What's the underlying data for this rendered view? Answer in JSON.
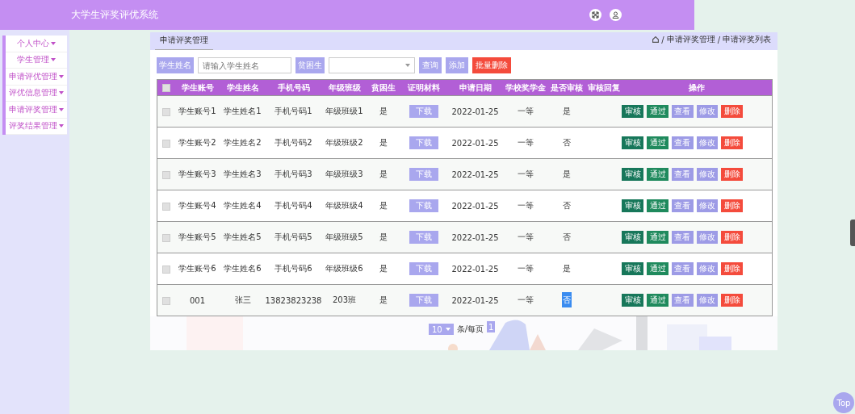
{
  "header": {
    "title": "大学生评奖评优系统"
  },
  "sidebar": {
    "items": [
      {
        "label": "个人中心"
      },
      {
        "label": "学生管理"
      },
      {
        "label": "申请评优管理"
      },
      {
        "label": "评优信息管理"
      },
      {
        "label": "申请评奖管理"
      },
      {
        "label": "评奖结果管理"
      }
    ]
  },
  "tab": {
    "label": "申请评奖管理"
  },
  "breadcrumb": [
    "/",
    "申请评奖管理",
    "/",
    "申请评奖列表"
  ],
  "toolbar": {
    "name_label": "学生姓名",
    "name_placeholder": "请输入学生姓名",
    "poor_label": "贫困生",
    "buttons": [
      {
        "label": "查询",
        "kind": "primary"
      },
      {
        "label": "添加",
        "kind": "primary"
      },
      {
        "label": "批量删除",
        "kind": "danger"
      }
    ]
  },
  "table": {
    "select_all_checked": false,
    "columns": [
      "学生账号",
      "学生姓名",
      "手机号码",
      "年级班级",
      "贫困生",
      "证明材料",
      "申请日期",
      "学校奖学金",
      "是否审核",
      "审核回复",
      "操作"
    ],
    "rows": [
      {
        "checked": false,
        "cells": [
          "学生账号1",
          "学生姓名1",
          "手机号码1",
          "年级班级1",
          "是",
          "下载",
          "2022-01-25",
          "一等",
          "是",
          ""
        ],
        "highlighted": false,
        "actions": [
          {
            "label": "审核",
            "kind": "dark"
          },
          {
            "label": "通过",
            "kind": "green"
          },
          {
            "label": "查看",
            "kind": "light"
          },
          {
            "label": "修改",
            "kind": "light"
          },
          {
            "label": "删除",
            "kind": "danger"
          }
        ]
      },
      {
        "checked": false,
        "cells": [
          "学生账号2",
          "学生姓名2",
          "手机号码2",
          "年级班级2",
          "是",
          "下载",
          "2022-01-25",
          "一等",
          "否",
          ""
        ],
        "highlighted": false,
        "actions": [
          {
            "label": "审核",
            "kind": "dark"
          },
          {
            "label": "通过",
            "kind": "green"
          },
          {
            "label": "查看",
            "kind": "light"
          },
          {
            "label": "修改",
            "kind": "light"
          },
          {
            "label": "删除",
            "kind": "danger"
          }
        ]
      },
      {
        "checked": false,
        "cells": [
          "学生账号3",
          "学生姓名3",
          "手机号码3",
          "年级班级3",
          "是",
          "下载",
          "2022-01-25",
          "一等",
          "是",
          ""
        ],
        "highlighted": false,
        "actions": [
          {
            "label": "审核",
            "kind": "dark"
          },
          {
            "label": "通过",
            "kind": "green"
          },
          {
            "label": "查看",
            "kind": "light"
          },
          {
            "label": "修改",
            "kind": "light"
          },
          {
            "label": "删除",
            "kind": "danger"
          }
        ]
      },
      {
        "checked": false,
        "cells": [
          "学生账号4",
          "学生姓名4",
          "手机号码4",
          "年级班级4",
          "是",
          "下载",
          "2022-01-25",
          "一等",
          "否",
          ""
        ],
        "highlighted": false,
        "actions": [
          {
            "label": "审核",
            "kind": "dark"
          },
          {
            "label": "通过",
            "kind": "green"
          },
          {
            "label": "查看",
            "kind": "light"
          },
          {
            "label": "修改",
            "kind": "light"
          },
          {
            "label": "删除",
            "kind": "danger"
          }
        ]
      },
      {
        "checked": false,
        "cells": [
          "学生账号5",
          "学生姓名5",
          "手机号码5",
          "年级班级5",
          "是",
          "下载",
          "2022-01-25",
          "一等",
          "否",
          ""
        ],
        "highlighted": false,
        "actions": [
          {
            "label": "审核",
            "kind": "dark"
          },
          {
            "label": "通过",
            "kind": "green"
          },
          {
            "label": "查看",
            "kind": "light"
          },
          {
            "label": "修改",
            "kind": "light"
          },
          {
            "label": "删除",
            "kind": "danger"
          }
        ]
      },
      {
        "checked": false,
        "cells": [
          "学生账号6",
          "学生姓名6",
          "手机号码6",
          "年级班级6",
          "是",
          "下载",
          "2022-01-25",
          "一等",
          "是",
          ""
        ],
        "highlighted": false,
        "actions": [
          {
            "label": "审核",
            "kind": "dark"
          },
          {
            "label": "通过",
            "kind": "green"
          },
          {
            "label": "查看",
            "kind": "light"
          },
          {
            "label": "修改",
            "kind": "light"
          },
          {
            "label": "删除",
            "kind": "danger"
          }
        ]
      },
      {
        "checked": false,
        "cells": [
          "001",
          "张三",
          "13823823238",
          "203班",
          "是",
          "下载",
          "2022-01-25",
          "一等",
          "否",
          ""
        ],
        "highlighted": true,
        "actions": [
          {
            "label": "审核",
            "kind": "dark"
          },
          {
            "label": "通过",
            "kind": "green"
          },
          {
            "label": "查看",
            "kind": "light"
          },
          {
            "label": "修改",
            "kind": "light"
          },
          {
            "label": "删除",
            "kind": "danger"
          }
        ]
      }
    ]
  },
  "pagination": {
    "page_size": "10",
    "per_page_label": "条/每页",
    "pages": [
      {
        "label": "1",
        "selected": true
      }
    ]
  },
  "top_button": {
    "label": "Top"
  }
}
